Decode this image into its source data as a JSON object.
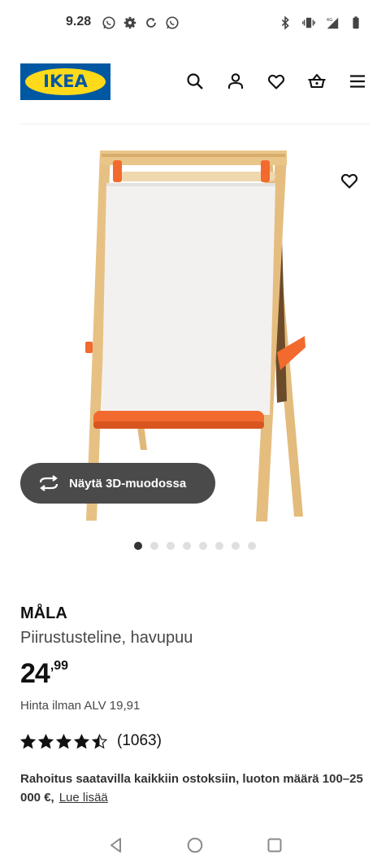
{
  "status_bar": {
    "time": "9.28",
    "left_icons": [
      "whatsapp-icon",
      "gear-icon",
      "sync-icon",
      "whatsapp-icon"
    ],
    "right_icons": [
      "bluetooth-icon",
      "vibrate-icon",
      "signal-4g-icon",
      "battery-icon"
    ]
  },
  "header": {
    "logo_text": "IKEA",
    "brand_colors": {
      "blue": "#0058a3",
      "yellow": "#ffda1a"
    },
    "icons": [
      "search-icon",
      "account-icon",
      "heart-icon",
      "basket-icon",
      "menu-icon"
    ]
  },
  "gallery": {
    "view_3d_label": "Näytä 3D-muodossa",
    "slide_count": 8,
    "active_slide": 1,
    "accent_orange": "#f26a2e"
  },
  "product": {
    "name": "MÅLA",
    "description": "Piirustusteline, havupuu",
    "price_integer": "24",
    "price_decimal": ",99",
    "price_ex_vat": "Hinta ilman ALV 19,91",
    "rating_value": 4.5,
    "rating_max": 5,
    "review_count": "(1063)",
    "financing_text": "Rahoitus saatavilla kaikkiin ostoksiin, luoton määrä 100–25 000 €,",
    "read_more": "Lue lisää"
  },
  "nav_bar": {
    "buttons": [
      "back-icon",
      "home-icon",
      "recents-icon"
    ]
  }
}
